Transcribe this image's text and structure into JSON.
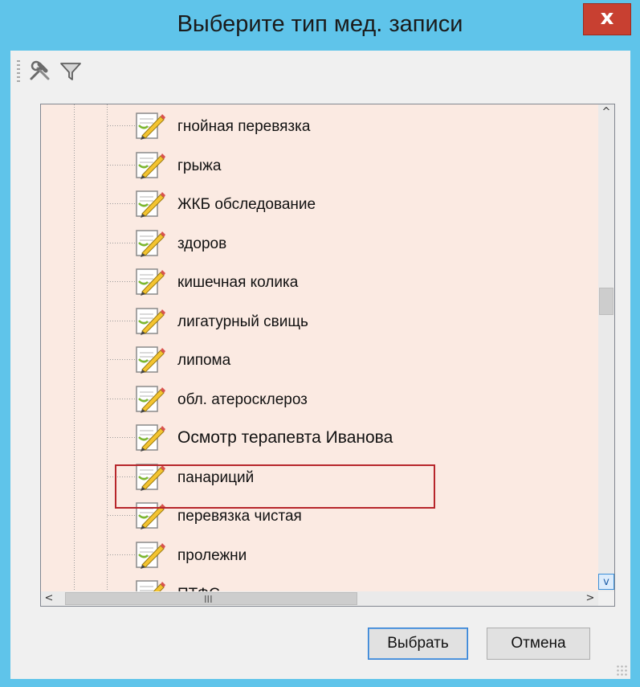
{
  "window": {
    "title": "Выберите тип мед. записи",
    "close_label": "x"
  },
  "toolbar": {
    "items": [
      {
        "icon": "tools-icon"
      },
      {
        "icon": "filter-icon"
      }
    ]
  },
  "tree": {
    "items": [
      {
        "label": "гнойная перевязка"
      },
      {
        "label": "грыжа"
      },
      {
        "label": "ЖКБ обследование"
      },
      {
        "label": "здоров"
      },
      {
        "label": "кишечная колика"
      },
      {
        "label": "лигатурный свищь"
      },
      {
        "label": "липома"
      },
      {
        "label": "обл. атеросклероз"
      },
      {
        "label": "Осмотр терапевта Иванова",
        "highlighted": true
      },
      {
        "label": "панариций"
      },
      {
        "label": "перевязка чистая"
      },
      {
        "label": "пролежни"
      },
      {
        "label": "ПТФС"
      }
    ],
    "highlight_color": "#b7262b",
    "background_color": "#fbeae2"
  },
  "scrollbars": {
    "up_arrow": "^",
    "down_arrow": "v",
    "left_arrow": "<",
    "right_arrow": ">",
    "thumb_grip": "III"
  },
  "buttons": {
    "ok_label": "Выбрать",
    "cancel_label": "Отмена"
  },
  "colors": {
    "title_bar": "#5fc4ea",
    "close_button": "#c84031",
    "focus_border": "#2c7cd3"
  }
}
